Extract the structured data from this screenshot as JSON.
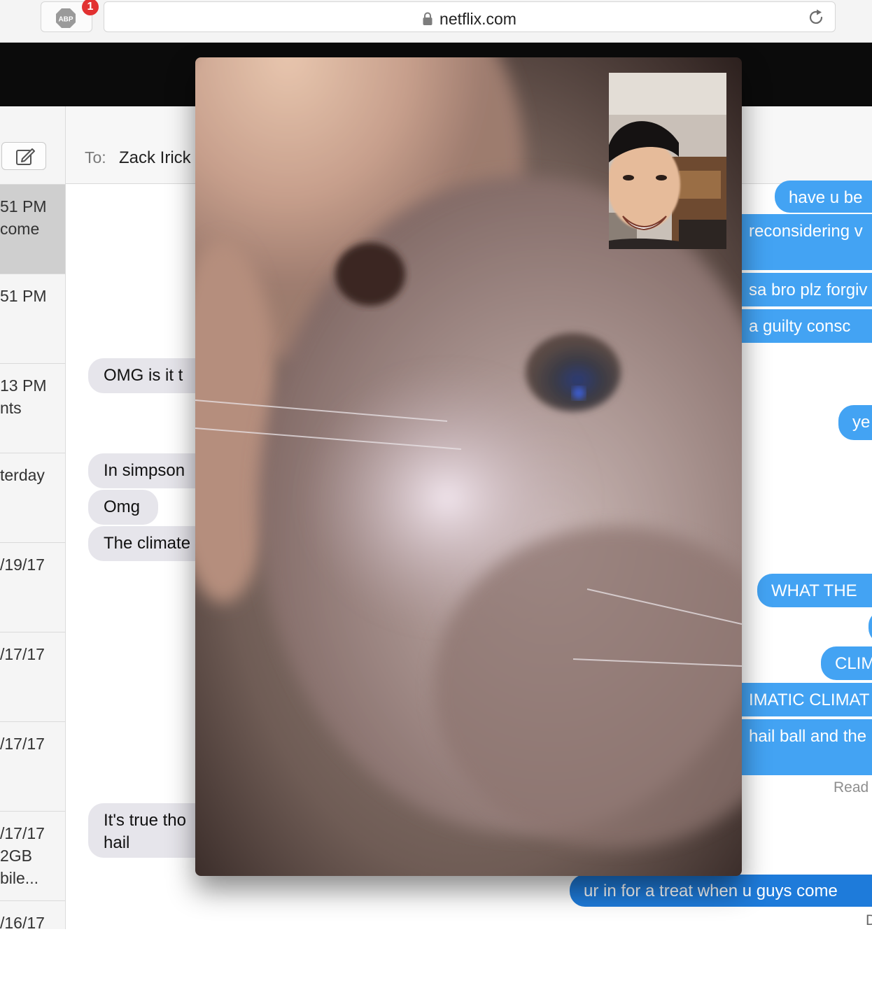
{
  "browser": {
    "adblock_label": "ABP",
    "adblock_badge": "1",
    "url": "netflix.com"
  },
  "sidebar": {
    "conversations": [
      {
        "lines": [
          "51 PM",
          "come"
        ],
        "selected": true
      },
      {
        "lines": [
          "51 PM"
        ]
      },
      {
        "lines": [
          "13 PM",
          "nts"
        ]
      },
      {
        "lines": [
          "terday"
        ]
      },
      {
        "lines": [
          "/19/17"
        ]
      },
      {
        "lines": [
          "/17/17"
        ]
      },
      {
        "lines": [
          "/17/17"
        ]
      },
      {
        "lines": [
          "/17/17",
          "2GB",
          "bile..."
        ]
      },
      {
        "lines": [
          "/16/17"
        ]
      }
    ]
  },
  "conversation": {
    "to_label": "To:",
    "to_name": "Zack Irick",
    "incoming": [
      "OMG is it t",
      "In simpson",
      "Omg",
      "The climate",
      "It's true tho",
      "hail"
    ],
    "outgoing": [
      "have u be",
      "reconsidering v",
      "sa bro plz forgiv",
      "a guilty consc",
      "ye",
      "WHAT THE",
      "CLIM",
      "IMATIC CLIMAT",
      "hail ball and the",
      "ur in for a treat when u guys come"
    ],
    "read_label": "Read",
    "delivered_label": "D"
  },
  "facetime": {
    "main_feed": "cat-close-up-video",
    "self_view": "smiling-person-video"
  },
  "colors": {
    "bubble_out": "#43a3f3",
    "bubble_out_dark": "#1e7bda",
    "bubble_in": "#e6e5eb",
    "badge": "#e23131"
  }
}
